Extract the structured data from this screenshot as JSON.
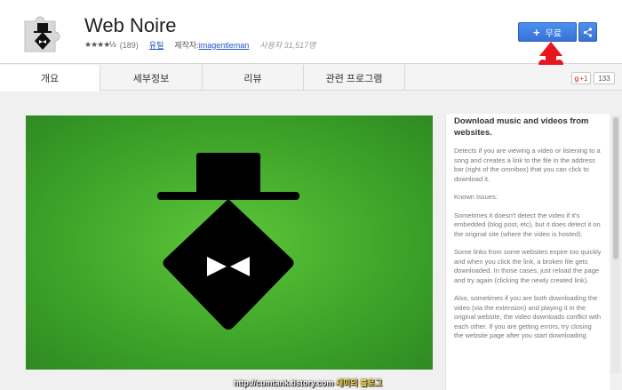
{
  "app": {
    "title": "Web Noire",
    "stars": "★★★★½",
    "rating_count": "(189)",
    "overview_link": "유틸",
    "author_label": "제작자:",
    "author_name": "imagentleman",
    "users": "사용자 31,517명"
  },
  "actions": {
    "free_label": "무료",
    "free_icon": "plus-icon",
    "share_icon": "share-icon",
    "accent": "#3a78dc",
    "annotation_color": "#e8141e"
  },
  "tabs": [
    {
      "label": "개요",
      "active": true
    },
    {
      "label": "세부정보",
      "active": false
    },
    {
      "label": "리뷰",
      "active": false
    },
    {
      "label": "관련 프로그램",
      "active": false
    }
  ],
  "social": {
    "gplus_label": "+1",
    "gplus_count": "133"
  },
  "description": {
    "heading": "Download music and videos from websites.",
    "paragraphs": [
      "Detects if you are viewing a video or listening to a song and creates a link to the file in the address bar (right of the omnibox) that you can click to download it.",
      "Known Issues:",
      "Sometimes it doesn't detect the video if it's embedded (blog post, etc), but it does detect it on the original site (where the video is hosted).",
      "Some links from some websites expire too quickly and when you click the link, a broken file gets downloaded. In those cases, just reload the page and try again (clicking the newly created link).",
      "Also, sometimes if you are both downloading the video (via the extension) and playing it in the original website, the video downloads conflict with each other. If you are getting errors, try closing the website page after you start downloading"
    ]
  },
  "watermark": {
    "url": "http://cumtank.tistory.com",
    "blog": "새미의 블로그"
  }
}
